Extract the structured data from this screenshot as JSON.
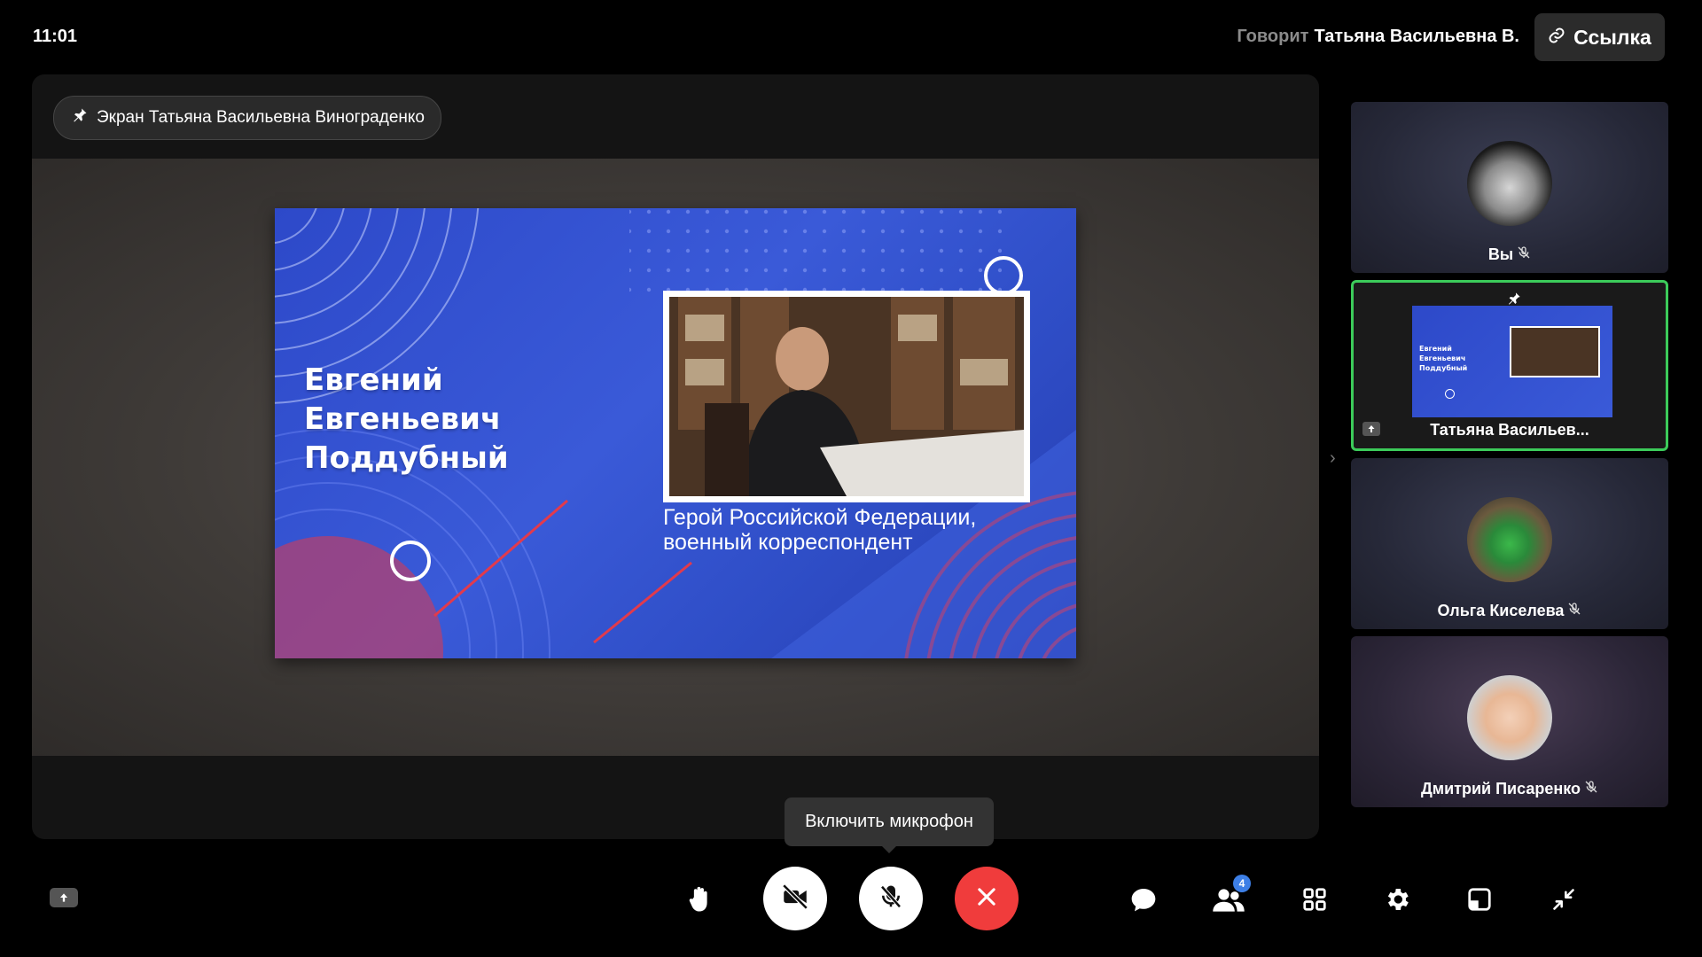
{
  "header": {
    "time": "11:01",
    "speaking_label": "Говорит",
    "speaker_name": "Татьяна Васильевна В.",
    "link_label": "Ссылка"
  },
  "stage": {
    "pinned_label": "Экран Татьяна Васильевна Винограденко",
    "slide": {
      "name_line1": "Евгений",
      "name_line2": "Евгеньевич",
      "name_line3": "Поддубный",
      "caption_line1": "Герой Российской Федерации,",
      "caption_line2": "военный корреспондент"
    }
  },
  "participants": [
    {
      "name": "Вы",
      "muted": true
    },
    {
      "name": "Татьяна Васильев...",
      "muted": false,
      "pinned": true,
      "sharing": true
    },
    {
      "name": "Ольга Киселева",
      "muted": true
    },
    {
      "name": "Дмитрий Писаренко",
      "muted": true
    }
  ],
  "thumbnail_slide": {
    "name_line1": "Евгений",
    "name_line2": "Евгеньевич",
    "name_line3": "Поддубный"
  },
  "tooltip": "Включить микрофон",
  "toolbar": {
    "participants_badge": "4"
  },
  "colors": {
    "accent_green": "#3ccb5a",
    "end_call_red": "#f03c3c",
    "badge_blue": "#3d7fe6"
  }
}
